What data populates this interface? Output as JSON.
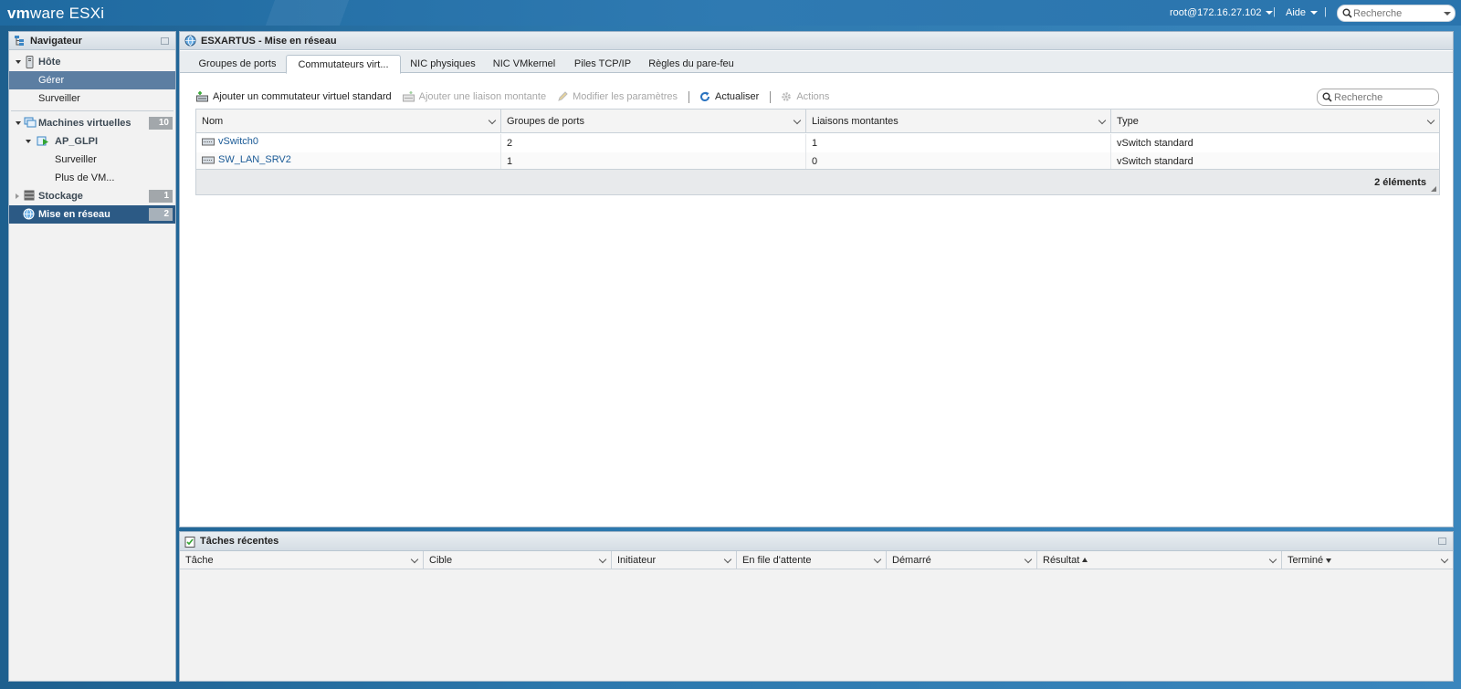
{
  "topbar": {
    "brand_bold": "vm",
    "brand_rest": "ware",
    "product": "ESXi",
    "user_menu": "root@172.16.27.102",
    "separator": "|",
    "help_menu": "Aide",
    "search_placeholder": "Recherche"
  },
  "navigator": {
    "title": "Navigateur",
    "host": {
      "label": "Hôte",
      "children": [
        "Gérer",
        "Surveiller"
      ]
    },
    "vms": {
      "label": "Machines virtuelles",
      "count": "10",
      "vm": {
        "label": "AP_GLPI",
        "children": [
          "Surveiller",
          "Plus de VM..."
        ]
      }
    },
    "storage": {
      "label": "Stockage",
      "count": "1"
    },
    "network": {
      "label": "Mise en réseau",
      "count": "2"
    }
  },
  "main": {
    "title": "ESXARTUS - Mise en réseau",
    "tabs": [
      "Groupes de ports",
      "Commutateurs virt...",
      "NIC physiques",
      "NIC VMkernel",
      "Piles TCP/IP",
      "Règles du pare-feu"
    ],
    "active_tab": 1,
    "toolbar": {
      "add_switch": "Ajouter un commutateur virtuel standard",
      "add_uplink": "Ajouter une liaison montante",
      "edit_settings": "Modifier les paramètres",
      "refresh": "Actualiser",
      "actions": "Actions"
    },
    "search_placeholder": "Recherche",
    "table": {
      "columns": [
        "Nom",
        "Groupes de ports",
        "Liaisons montantes",
        "Type"
      ],
      "rows": [
        [
          "vSwitch0",
          "2",
          "1",
          "vSwitch standard"
        ],
        [
          "SW_LAN_SRV2",
          "1",
          "0",
          "vSwitch standard"
        ]
      ],
      "footer": "2 éléments"
    }
  },
  "tasks": {
    "title": "Tâches récentes",
    "columns": [
      "Tâche",
      "Cible",
      "Initiateur",
      "En file d'attente",
      "Démarré",
      "Résultat",
      "Terminé"
    ]
  },
  "colors": {
    "accent": "#2c78ad",
    "nav_selected": "#5c7ea2",
    "nav_active": "#2c5a85",
    "link": "#1a5a96"
  }
}
